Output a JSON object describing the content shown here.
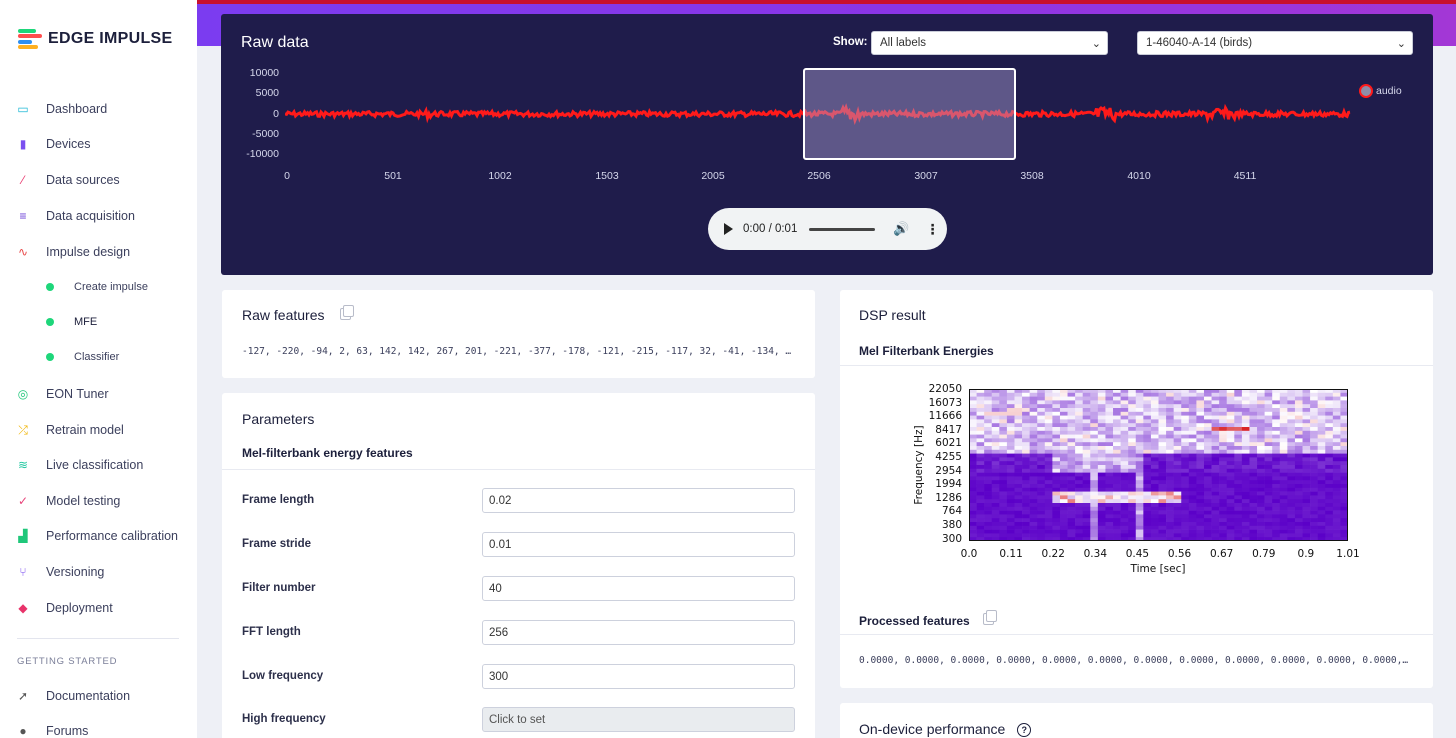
{
  "app": {
    "logo_text": "EDGE IMPULSE",
    "logo_colors": [
      "#1ed67a",
      "#ff4d4d",
      "#2f8ff0",
      "#ffb020"
    ]
  },
  "sidebar": {
    "items": [
      {
        "label": "Dashboard",
        "icon": "monitor-icon",
        "color": "#1fb8d6"
      },
      {
        "label": "Devices",
        "icon": "chip-icon",
        "color": "#7b4ff0"
      },
      {
        "label": "Data sources",
        "icon": "magic-wand-icon",
        "color": "#e8336a"
      },
      {
        "label": "Data acquisition",
        "icon": "database-icon",
        "color": "#6b3fd6"
      },
      {
        "label": "Impulse design",
        "icon": "pulse-icon",
        "color": "#e84a4a"
      },
      {
        "label": "EON Tuner",
        "icon": "tuner-icon",
        "color": "#1fc77a"
      },
      {
        "label": "Retrain model",
        "icon": "shuffle-icon",
        "color": "#f0b400"
      },
      {
        "label": "Live classification",
        "icon": "live-icon",
        "color": "#1fc7a0"
      },
      {
        "label": "Model testing",
        "icon": "clipboard-check-icon",
        "color": "#e8447a"
      },
      {
        "label": "Performance calibration",
        "icon": "bar-chart-icon",
        "color": "#1fc77a"
      },
      {
        "label": "Versioning",
        "icon": "branch-icon",
        "color": "#7b4ff0"
      },
      {
        "label": "Deployment",
        "icon": "package-icon",
        "color": "#e8336a"
      }
    ],
    "sub_items": [
      {
        "label": "Create impulse"
      },
      {
        "label": "MFE"
      },
      {
        "label": "Classifier"
      }
    ],
    "section_heading": "GETTING STARTED",
    "footer_items": [
      {
        "label": "Documentation",
        "icon": "rocket-icon"
      },
      {
        "label": "Forums",
        "icon": "chat-icon"
      }
    ]
  },
  "raw_data": {
    "title": "Raw data",
    "show_label": "Show:",
    "labels_select": "All labels",
    "sample_select": "1-46040-A-14 (birds)",
    "y_ticks": [
      "10000",
      "5000",
      "0",
      "-5000",
      "-10000"
    ],
    "x_ticks": [
      "0",
      "501",
      "1002",
      "1503",
      "2005",
      "2506",
      "3007",
      "3508",
      "4010",
      "4511"
    ],
    "legend": "audio",
    "audio_time": "0:00 / 0:01",
    "waveform_color": "#ff1a1a"
  },
  "raw_features": {
    "title": "Raw features",
    "values": "-127, -220, -94, 2, 63, 142, 142, 267, 201, -221, -377, -178, -121, -215, -117, 32, -41, -134, …"
  },
  "parameters": {
    "title": "Parameters",
    "subtitle": "Mel-filterbank energy features",
    "fields": [
      {
        "label": "Frame length",
        "value": "0.02"
      },
      {
        "label": "Frame stride",
        "value": "0.01"
      },
      {
        "label": "Filter number",
        "value": "40"
      },
      {
        "label": "FFT length",
        "value": "256"
      },
      {
        "label": "Low frequency",
        "value": "300"
      },
      {
        "label": "High frequency",
        "value": "Click to set"
      }
    ]
  },
  "dsp": {
    "title": "DSP result",
    "subtitle": "Mel Filterbank Energies",
    "processed_title": "Processed features",
    "processed_values": "0.0000, 0.0000, 0.0000, 0.0000, 0.0000, 0.0000, 0.0000, 0.0000, 0.0000, 0.0000, 0.0000, 0.0000,…",
    "on_device_title": "On-device performance"
  },
  "chart_data": {
    "type": "heatmap",
    "xlabel": "Time [sec]",
    "ylabel": "Frequency [Hz]",
    "x_ticks": [
      "0.0",
      "0.11",
      "0.22",
      "0.34",
      "0.45",
      "0.56",
      "0.67",
      "0.79",
      "0.9",
      "1.01"
    ],
    "y_ticks": [
      "22050",
      "16073",
      "11666",
      "8417",
      "6021",
      "4255",
      "2954",
      "1994",
      "1286",
      "764",
      "380",
      "300"
    ],
    "colormap": [
      "#5b00c8",
      "#ffffff",
      "#d7191c"
    ]
  }
}
